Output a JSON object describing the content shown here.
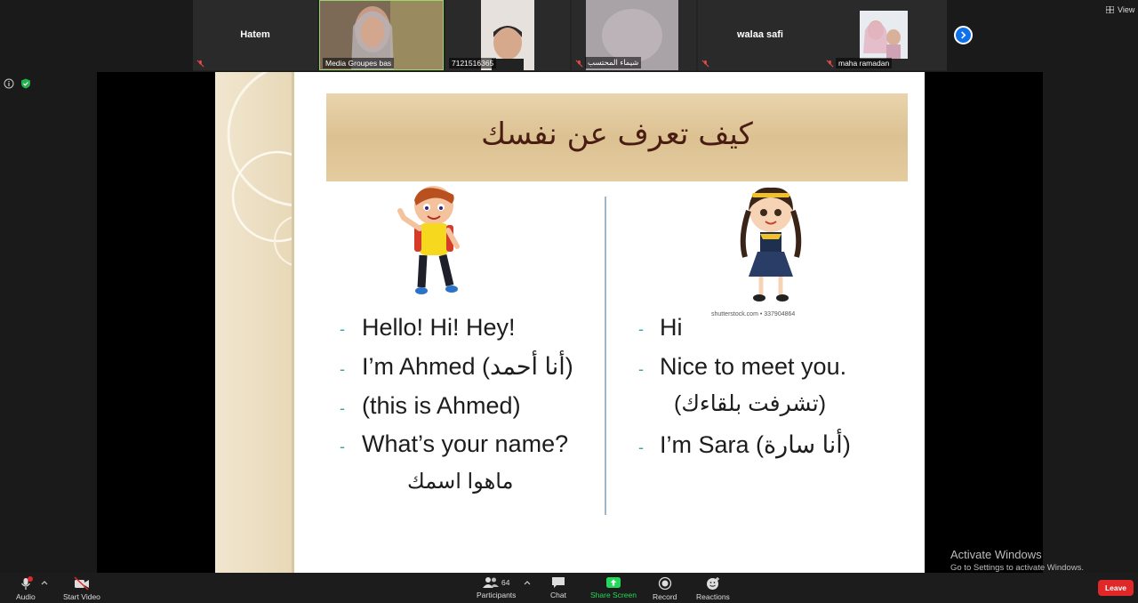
{
  "participants_strip": {
    "tiles": [
      {
        "name": "Hatem"
      },
      {
        "name": "Media Groupes bas"
      },
      {
        "name": "7121516365"
      },
      {
        "name": "شيماء المحتسب"
      },
      {
        "name": "walaa safi"
      },
      {
        "name": "maha ramadan"
      }
    ],
    "view_label": "View"
  },
  "slide": {
    "title": "كيف تعرف عن نفسك",
    "left_lines": [
      "Hello! Hi! Hey!",
      "I’m Ahmed (أنا أحمد)",
      "(this is Ahmed)",
      "What’s your name?",
      "ماهوا اسمك"
    ],
    "right_lines": [
      "Hi",
      "Nice to meet you.",
      "(تشرفت بلقاءك)",
      "I’m Sara  (أنا سارة)"
    ],
    "watermark": "shutterstock.com • 337904864"
  },
  "activation": {
    "line1": "Activate Windows",
    "line2": "Go to Settings to activate Windows."
  },
  "toolbar": {
    "audio": "Audio",
    "start_video": "Start Video",
    "participants": "Participants",
    "participants_count": "64",
    "chat": "Chat",
    "share_screen": "Share Screen",
    "record": "Record",
    "reactions": "Reactions",
    "leave": "Leave"
  },
  "colors": {
    "share_green": "#23d959",
    "leave_red": "#e02828",
    "next_blue": "#0e71eb"
  }
}
